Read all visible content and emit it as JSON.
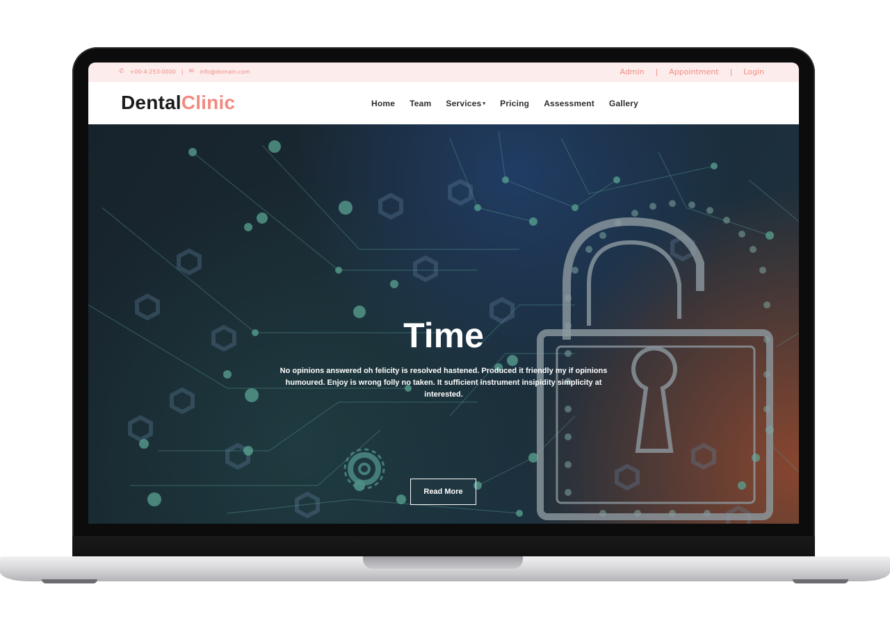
{
  "topbar": {
    "phone_icon": "phone-icon",
    "phone": "+00-4-253-0000",
    "separator": "|",
    "email_icon": "envelope-icon",
    "email": "info@domain.com",
    "links": [
      "Admin",
      "Appointment",
      "Login"
    ]
  },
  "brand": {
    "part1": "Dental",
    "part2": "Clinic"
  },
  "nav": {
    "items": [
      "Home",
      "Team",
      "Services",
      "Pricing",
      "Assessment",
      "Gallery"
    ],
    "services_caret": "▾"
  },
  "hero": {
    "title": "Time",
    "text": "No opinions answered oh felicity is resolved hastened. Produced it friendly my if opinions humoured. Enjoy is wrong folly no taken. It sufficient instrument insipidity simplicity at interested.",
    "button": "Read More"
  },
  "colors": {
    "accent": "#f28a80",
    "topbar_bg": "#fdecec",
    "brand_dark": "#1b1b1b",
    "hero_text": "#ffffff"
  }
}
